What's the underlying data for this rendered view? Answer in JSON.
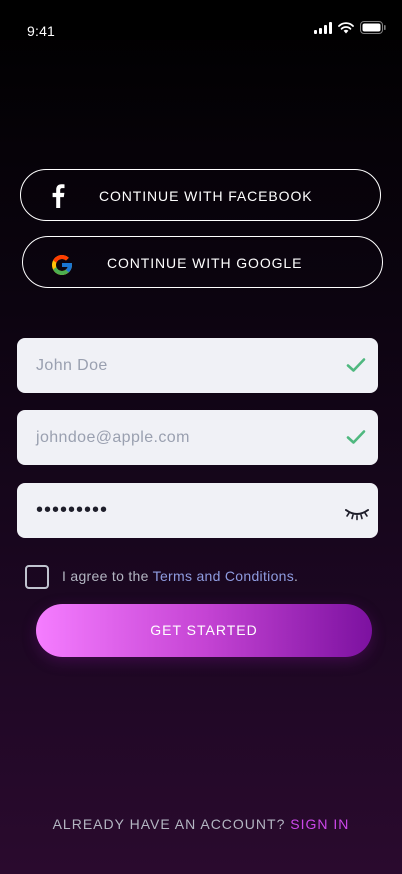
{
  "status_bar": {
    "time": "9:41"
  },
  "social": {
    "facebook_label": "CONTINUE WITH FACEBOOK",
    "google_label": "CONTINUE WITH GOOGLE"
  },
  "form": {
    "name_value": "John Doe",
    "email_value": "johndoe@apple.com",
    "password_value": "•••••••••",
    "agree_prefix": "I agree to the ",
    "terms_link": "Terms and Conditions",
    "agree_suffix": ".",
    "submit_label": "GET STARTED"
  },
  "footer": {
    "question": "ALREADY HAVE AN ACCOUNT?",
    "signin_link": "SIGN IN"
  },
  "colors": {
    "accent_pink": "#f57dff",
    "accent_purple": "#7c11a0",
    "link_blue": "#8f9ce0",
    "signin": "#cc47ea",
    "valid_check": "#4fb87f"
  },
  "icons": [
    "signal-icon",
    "wifi-icon",
    "battery-icon",
    "facebook-icon",
    "google-icon",
    "check-icon",
    "eye-closed-icon"
  ]
}
